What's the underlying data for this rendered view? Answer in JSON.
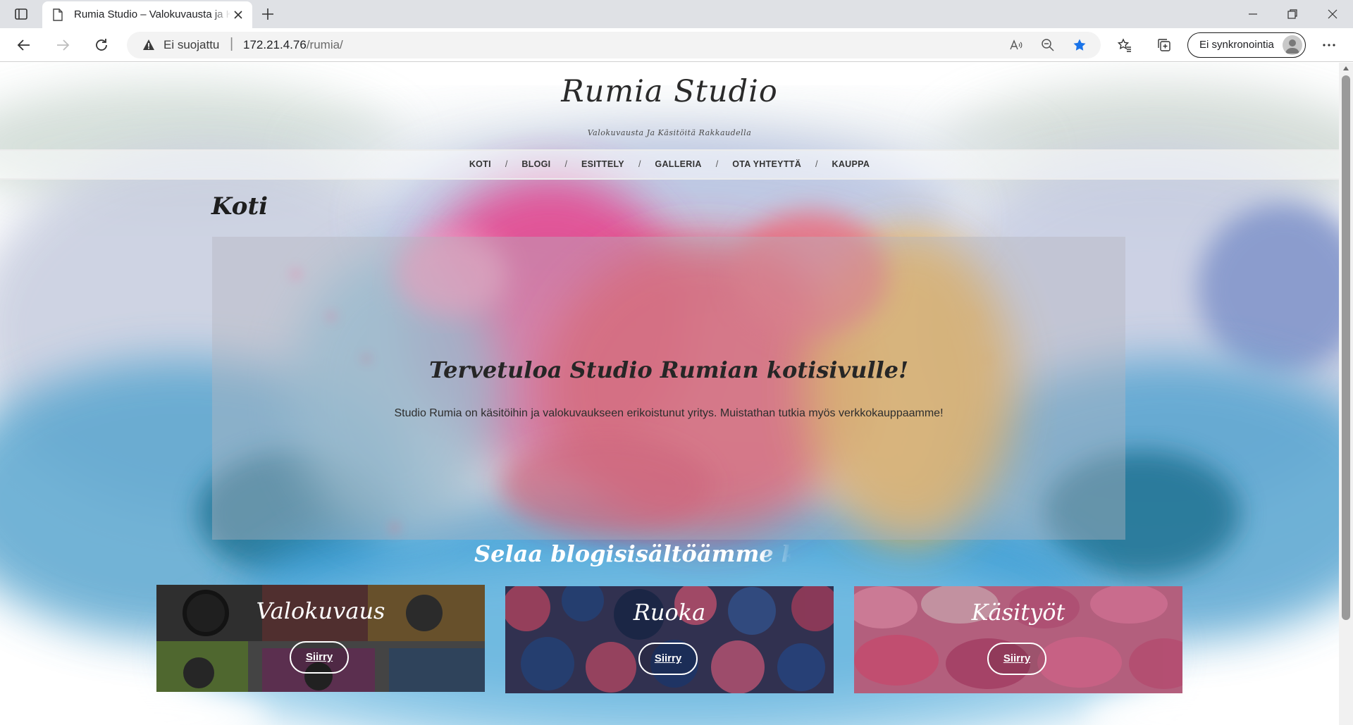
{
  "browser": {
    "tab_title": "Rumia Studio – Valokuvausta ja Käsitöitä Rakkaudella",
    "security_label": "Ei suojattu",
    "url_host": "172.21.4.76",
    "url_path": "/rumia/",
    "sync_label": "Ei synkronointia",
    "icons": [
      "tab-actions-icon",
      "page-icon",
      "close-icon",
      "new-tab-icon",
      "minimize-icon",
      "restore-icon",
      "window-close-icon",
      "back-icon",
      "forward-icon",
      "refresh-icon",
      "warning-icon",
      "read-aloud-icon",
      "zoom-out-icon",
      "favorite-star-icon",
      "favorites-icon",
      "collections-icon",
      "profile-avatar-icon",
      "more-icon"
    ],
    "accent_color": "#1a73e8"
  },
  "site": {
    "title": "Rumia Studio",
    "tagline": "Valokuvausta Ja Käsitöitä Rakkaudella",
    "nav": [
      "KOTI",
      "BLOGI",
      "ESITTELY",
      "GALLERIA",
      "OTA YHTEYTTÄ",
      "KAUPPA"
    ],
    "nav_separator": "/"
  },
  "main": {
    "heading": "Koti",
    "hero_title": "Tervetuloa Studio Rumian kotisivulle!",
    "hero_text": "Studio Rumia on käsitöihin ja valokuvaukseen erikoistunut yritys. Muistathan tutkia myös verkkokauppaamme!",
    "categories_heading": "Selaa blogisisältöämme kategorioittain",
    "categories": [
      {
        "title": "Valokuvaus",
        "button": "Siirry"
      },
      {
        "title": "Ruoka",
        "button": "Siirry"
      },
      {
        "title": "Käsityöt",
        "button": "Siirry"
      }
    ]
  }
}
